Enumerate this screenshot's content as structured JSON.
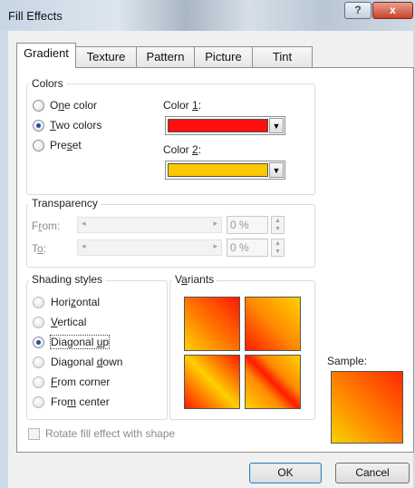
{
  "window": {
    "title": "Fill Effects",
    "help_label": "?",
    "close_label": "x"
  },
  "tabs": [
    {
      "label": "Gradient",
      "active": true
    },
    {
      "label": "Texture"
    },
    {
      "label": "Pattern"
    },
    {
      "label": "Picture"
    },
    {
      "label": "Tint"
    }
  ],
  "colors": {
    "legend": "Colors",
    "options": [
      {
        "pre": "O",
        "key": "n",
        "post": "e color",
        "checked": false
      },
      {
        "pre": "",
        "key": "T",
        "post": "wo colors",
        "checked": true
      },
      {
        "pre": "Pre",
        "key": "s",
        "post": "et",
        "checked": false
      }
    ],
    "color1": {
      "pre": "Color ",
      "key": "1",
      "post": ":",
      "value": "#ff1010"
    },
    "color2": {
      "pre": "Color ",
      "key": "2",
      "post": ":",
      "value": "#fcc800"
    }
  },
  "transparency": {
    "legend": "Transparency",
    "from": {
      "pre": "F",
      "key": "r",
      "post": "om:",
      "value": "0 %"
    },
    "to": {
      "pre": "T",
      "key": "o",
      "post": ":",
      "value": "0 %"
    }
  },
  "shading": {
    "legend": "Shading styles",
    "options": [
      {
        "pre": "Hori",
        "key": "z",
        "post": "ontal",
        "checked": false
      },
      {
        "pre": "",
        "key": "V",
        "post": "ertical",
        "checked": false
      },
      {
        "pre": "Diagonal ",
        "key": "u",
        "post": "p",
        "checked": true
      },
      {
        "pre": "Diagonal ",
        "key": "d",
        "post": "own",
        "checked": false
      },
      {
        "pre": "",
        "key": "F",
        "post": "rom corner",
        "checked": false
      },
      {
        "pre": "Fro",
        "key": "m",
        "post": " center",
        "checked": false
      }
    ]
  },
  "variants": {
    "pre": "V",
    "key": "a",
    "post": "riants"
  },
  "sample": {
    "label": "Sample:"
  },
  "rotate_checkbox": {
    "label": "Rotate fill effect with shape",
    "checked": false
  },
  "buttons": {
    "ok": "OK",
    "cancel": "Cancel"
  },
  "accent_colors": {
    "gradient_start": "#ff1a00",
    "gradient_end": "#f7d200"
  }
}
